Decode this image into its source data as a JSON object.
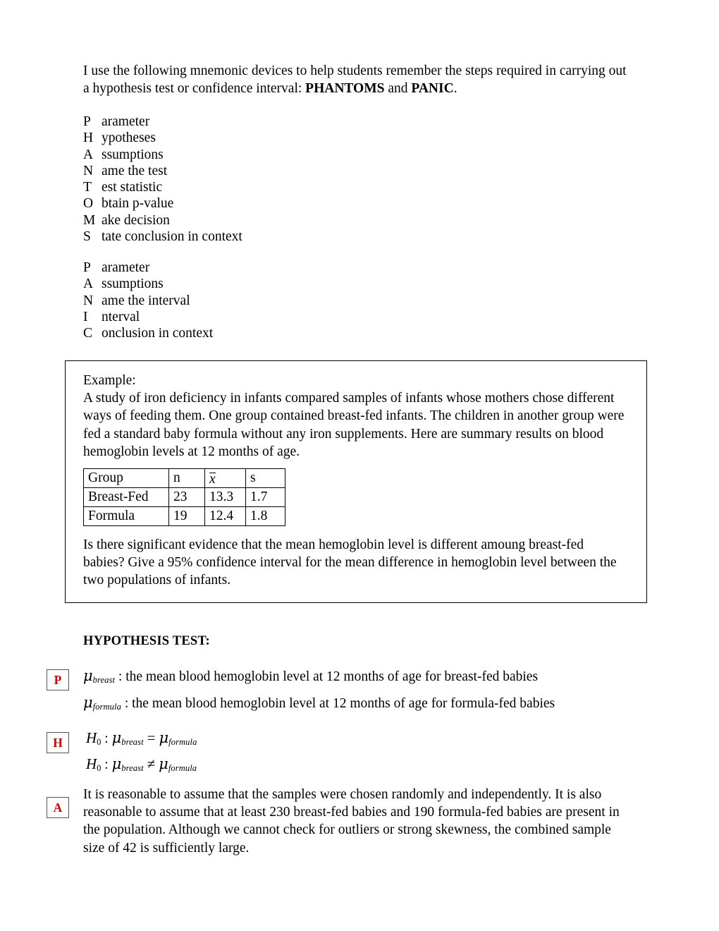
{
  "document": {
    "intro": {
      "line1": "I use the following mnemonic devices to help students remember the steps required in carrying",
      "line2_pre": "out a hypothesis test or confidence interval: ",
      "line2_bold1": "PHANTOMS",
      "line2_mid": " and ",
      "line2_bold2": "PANIC",
      "line2_end": "."
    },
    "phantoms": [
      {
        "letter": "P",
        "rest": "arameter"
      },
      {
        "letter": "H",
        "rest": "ypotheses"
      },
      {
        "letter": "A",
        "rest": "ssumptions"
      },
      {
        "letter": "N",
        "rest": "ame the test"
      },
      {
        "letter": "T",
        "rest": "est statistic"
      },
      {
        "letter": "O",
        "rest": "btain p-value"
      },
      {
        "letter": "M",
        "rest": "ake decision"
      },
      {
        "letter": "S",
        "rest": "tate conclusion in context"
      }
    ],
    "panic": [
      {
        "letter": "P",
        "rest": "arameter"
      },
      {
        "letter": "A",
        "rest": "ssumptions"
      },
      {
        "letter": "N",
        "rest": "ame the interval"
      },
      {
        "letter": "I",
        "rest": "nterval"
      },
      {
        "letter": "C",
        "rest": "onclusion in context"
      }
    ],
    "example": {
      "label": "Example:",
      "paragraph": "A study of iron deficiency in infants compared samples of infants whose mothers chose different ways of feeding them.  One group contained breast-fed infants.  The children in another group were fed a standard baby formula without any iron supplements.  Here are summary results on blood hemoglobin levels at 12 months of age.",
      "table": {
        "headers": [
          "Group",
          "n",
          "x",
          "s"
        ],
        "rows": [
          [
            "Breast-Fed",
            "23",
            "13.3",
            "1.7"
          ],
          [
            "Formula",
            "19",
            "12.4",
            "1.8"
          ]
        ]
      },
      "question": "Is there significant evidence that the mean hemoglobin level is different amoung breast-fed babies?  Give a 95% confidence interval for the mean difference in hemoglobin level between the two populations of infants."
    },
    "hypothesis_test": {
      "heading": "HYPOTHESIS TEST:",
      "steps": {
        "parameter": {
          "box_letter": "P",
          "mu_symbol": "μ",
          "line1_sub": "breast",
          "line1_text": " : the mean blood hemoglobin level at 12 months of age for breast-fed babies",
          "line2_sub": "formula",
          "line2_text": " : the mean blood hemoglobin level at 12 months of age for formula-fed babies"
        },
        "hypotheses": {
          "box_letter": "H",
          "h_symbol": "H",
          "h_sub": "0",
          "colon": " : ",
          "mu_symbol": "μ",
          "sub_breast": "breast",
          "sub_formula": "formula",
          "op_equal": "=",
          "op_notequal": "≠"
        },
        "assumptions": {
          "box_letter": "A",
          "text": "It is reasonable to assume that the samples were chosen randomly and independently.  It is also reasonable to assume that at least 230 breast-fed babies and 190 formula-fed babies are present in the population.  Although we cannot check for outliers or strong skewness, the combined sample size of 42 is sufficiently large."
        }
      }
    },
    "colors": {
      "letter_box_text": "#e00000",
      "letter_box_border": "#555555",
      "text": "#000000",
      "background": "#ffffff"
    }
  }
}
